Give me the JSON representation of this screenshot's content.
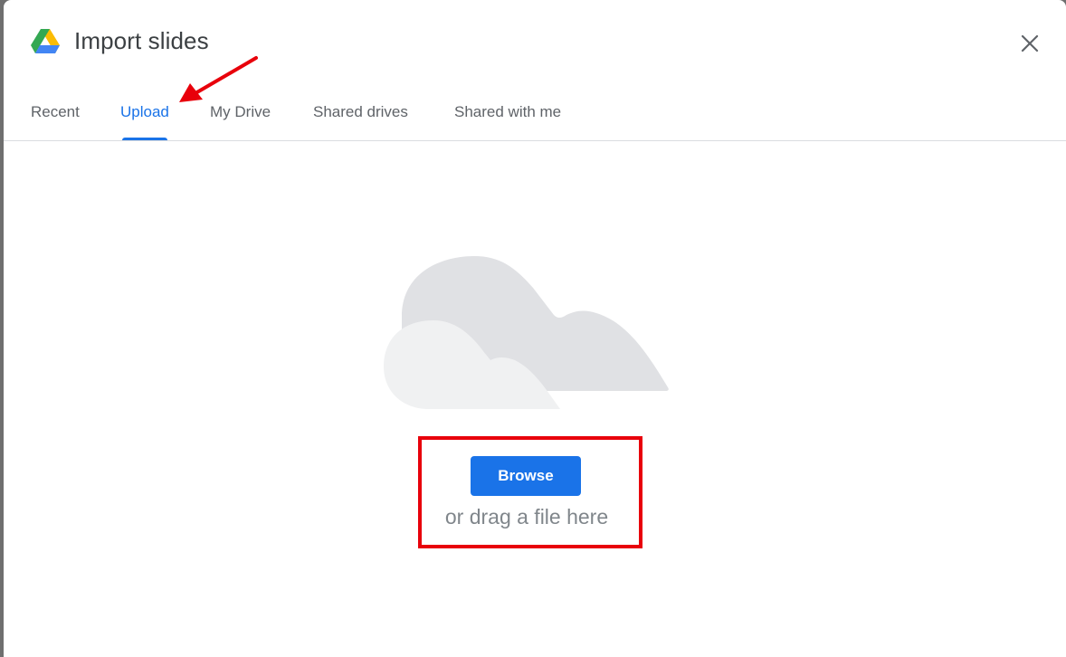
{
  "dialog": {
    "title": "Import slides",
    "close_icon": "close-icon",
    "logo_icon": "google-drive-logo"
  },
  "tabs": [
    {
      "label": "Recent",
      "active": false
    },
    {
      "label": "Upload",
      "active": true
    },
    {
      "label": "My Drive",
      "active": false
    },
    {
      "label": "Shared drives",
      "active": false
    },
    {
      "label": "Shared with me",
      "active": false
    }
  ],
  "upload": {
    "browse_label": "Browse",
    "drag_text": "or drag a file here",
    "illustration": "cloud-illustration"
  },
  "annotations": {
    "arrow_color": "#e8000b",
    "box_color": "#e8000b"
  },
  "colors": {
    "accent": "#1a73e8",
    "text_muted": "#5f6368"
  }
}
